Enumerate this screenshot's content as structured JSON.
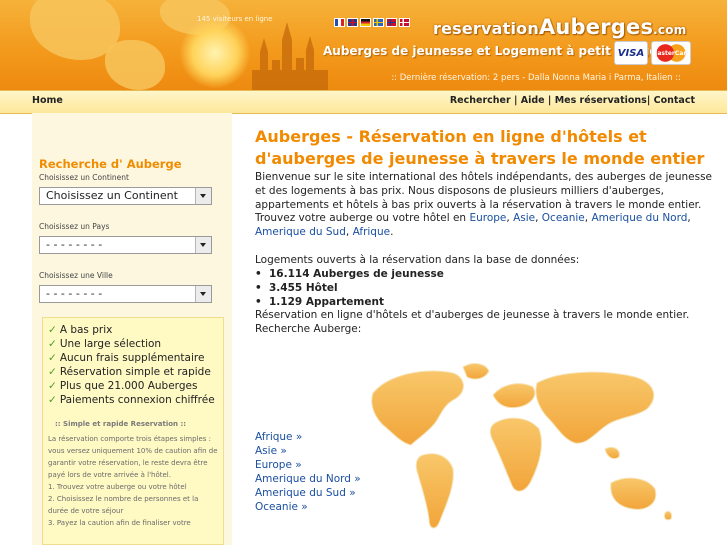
{
  "header": {
    "visitors": "145 visiteurs en ligne",
    "logo_part1": "reservation",
    "logo_part2": "Auberges",
    "logo_part3": ".com",
    "tagline": "Auberges de jeunesse et Logement à petit budget",
    "card_visa": "VISA",
    "card_mastercard": "MasterCard",
    "last_reservation": ":: Dernière réservation: 2 pers - Dalla Nonna Maria i Parma, Italien ::",
    "flags": [
      {
        "name": "flag-fr-icon",
        "color": "#2b4ea8"
      },
      {
        "name": "flag-uk-icon",
        "color": "#1f3a8a"
      },
      {
        "name": "flag-de-icon",
        "color": "#d9a300"
      },
      {
        "name": "flag-se-icon",
        "color": "#2b66b5"
      },
      {
        "name": "flag-no-icon",
        "color": "#c8102e"
      },
      {
        "name": "flag-dk-icon",
        "color": "#c8102e"
      }
    ]
  },
  "nav": {
    "home": "Home",
    "rechercher": "Rechercher",
    "sep1": " | ",
    "aide": "Aide",
    "sep2": " | ",
    "mes_reservations": "Mes réservations",
    "sep3": "| ",
    "contact": "Contact"
  },
  "sidebar": {
    "title": "Recherche d' Auberge",
    "continent_label": "Choisissez un Continent",
    "continent_value": "Choisissez un Continent",
    "pays_label": "Choisissez un Pays",
    "pays_value": "- - - - - - - -",
    "ville_label": "Choisissez une Ville",
    "ville_value": "- - - - - - - -",
    "benefits": [
      "A bas prix",
      "Une large sélection",
      "Aucun frais supplémentaire",
      "Réservation simple et rapide",
      "Plus que 21.000 Auberges",
      "Paiements connexion chiffrée"
    ],
    "steps_title": ":: Simple et rapide Reservation ::",
    "steps_text_1": "La réservation comporte trois étapes simples : vous versez uniquement 10% de caution afin de garantir votre réservation, le reste devra être payé lors de votre arrivée à l'hôtel.",
    "steps_text_2": "1. Trouvez votre auberge ou votre hôtel",
    "steps_text_3": "2. Choisissez le nombre de personnes et la durée de votre séjour",
    "steps_text_4": "3. Payez la caution afin de finaliser votre"
  },
  "main": {
    "title": "Auberges - Réservation en ligne d'hôtels et d'auberges de jeunesse à travers le monde entier",
    "intro": "Bienvenue sur le site international des hôtels indépendants, des auberges de jeunesse et des logements à bas prix. Nous disposons de plusieurs milliers d'auberges, appartements et hôtels à bas prix ouverts à la réservation à travers le monde entier. Trouvez votre auberge ou votre hôtel en",
    "intro_links": [
      "Europe",
      "Asie",
      "Oceanie",
      "Amerique du Nord",
      "Amerique du Sud",
      "Afrique"
    ],
    "stats_label": "Logements ouverts à la réservation dans la base de données:",
    "stats": [
      "16.114 Auberges de jeunesse",
      "3.455 Hôtel",
      "1.129 Appartement"
    ],
    "recherche_text": "Réservation en ligne d'hôtels et d'auberges de jeunesse à travers le monde entier. Recherche Auberge:",
    "continent_links": [
      "Afrique »",
      "Asie »",
      "Europe »",
      "Amerique du Nord »",
      "Amerique du Sud »",
      "Oceanie »"
    ]
  },
  "colors": {
    "header_orange": "#f39a1c",
    "accent_title": "#f18a00",
    "link_blue": "#1a4fa0",
    "check_green": "#4a9e2a"
  }
}
